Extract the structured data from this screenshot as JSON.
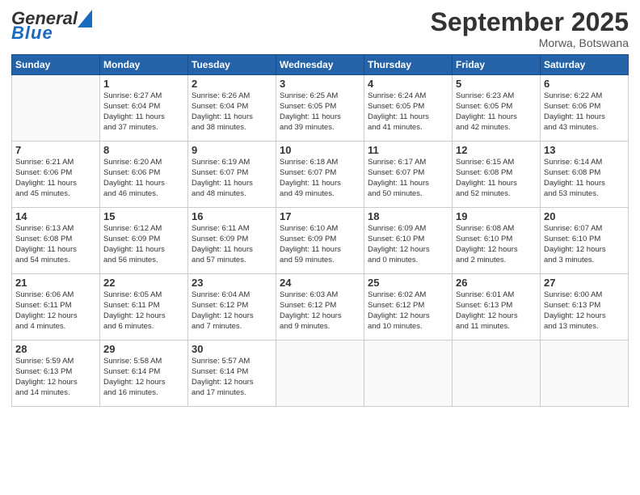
{
  "header": {
    "logo_general": "General",
    "logo_blue": "Blue",
    "month_title": "September 2025",
    "subtitle": "Morwa, Botswana"
  },
  "weekdays": [
    "Sunday",
    "Monday",
    "Tuesday",
    "Wednesday",
    "Thursday",
    "Friday",
    "Saturday"
  ],
  "weeks": [
    [
      {
        "day": "",
        "info": ""
      },
      {
        "day": "1",
        "info": "Sunrise: 6:27 AM\nSunset: 6:04 PM\nDaylight: 11 hours\nand 37 minutes."
      },
      {
        "day": "2",
        "info": "Sunrise: 6:26 AM\nSunset: 6:04 PM\nDaylight: 11 hours\nand 38 minutes."
      },
      {
        "day": "3",
        "info": "Sunrise: 6:25 AM\nSunset: 6:05 PM\nDaylight: 11 hours\nand 39 minutes."
      },
      {
        "day": "4",
        "info": "Sunrise: 6:24 AM\nSunset: 6:05 PM\nDaylight: 11 hours\nand 41 minutes."
      },
      {
        "day": "5",
        "info": "Sunrise: 6:23 AM\nSunset: 6:05 PM\nDaylight: 11 hours\nand 42 minutes."
      },
      {
        "day": "6",
        "info": "Sunrise: 6:22 AM\nSunset: 6:06 PM\nDaylight: 11 hours\nand 43 minutes."
      }
    ],
    [
      {
        "day": "7",
        "info": "Sunrise: 6:21 AM\nSunset: 6:06 PM\nDaylight: 11 hours\nand 45 minutes."
      },
      {
        "day": "8",
        "info": "Sunrise: 6:20 AM\nSunset: 6:06 PM\nDaylight: 11 hours\nand 46 minutes."
      },
      {
        "day": "9",
        "info": "Sunrise: 6:19 AM\nSunset: 6:07 PM\nDaylight: 11 hours\nand 48 minutes."
      },
      {
        "day": "10",
        "info": "Sunrise: 6:18 AM\nSunset: 6:07 PM\nDaylight: 11 hours\nand 49 minutes."
      },
      {
        "day": "11",
        "info": "Sunrise: 6:17 AM\nSunset: 6:07 PM\nDaylight: 11 hours\nand 50 minutes."
      },
      {
        "day": "12",
        "info": "Sunrise: 6:15 AM\nSunset: 6:08 PM\nDaylight: 11 hours\nand 52 minutes."
      },
      {
        "day": "13",
        "info": "Sunrise: 6:14 AM\nSunset: 6:08 PM\nDaylight: 11 hours\nand 53 minutes."
      }
    ],
    [
      {
        "day": "14",
        "info": "Sunrise: 6:13 AM\nSunset: 6:08 PM\nDaylight: 11 hours\nand 54 minutes."
      },
      {
        "day": "15",
        "info": "Sunrise: 6:12 AM\nSunset: 6:09 PM\nDaylight: 11 hours\nand 56 minutes."
      },
      {
        "day": "16",
        "info": "Sunrise: 6:11 AM\nSunset: 6:09 PM\nDaylight: 11 hours\nand 57 minutes."
      },
      {
        "day": "17",
        "info": "Sunrise: 6:10 AM\nSunset: 6:09 PM\nDaylight: 11 hours\nand 59 minutes."
      },
      {
        "day": "18",
        "info": "Sunrise: 6:09 AM\nSunset: 6:10 PM\nDaylight: 12 hours\nand 0 minutes."
      },
      {
        "day": "19",
        "info": "Sunrise: 6:08 AM\nSunset: 6:10 PM\nDaylight: 12 hours\nand 2 minutes."
      },
      {
        "day": "20",
        "info": "Sunrise: 6:07 AM\nSunset: 6:10 PM\nDaylight: 12 hours\nand 3 minutes."
      }
    ],
    [
      {
        "day": "21",
        "info": "Sunrise: 6:06 AM\nSunset: 6:11 PM\nDaylight: 12 hours\nand 4 minutes."
      },
      {
        "day": "22",
        "info": "Sunrise: 6:05 AM\nSunset: 6:11 PM\nDaylight: 12 hours\nand 6 minutes."
      },
      {
        "day": "23",
        "info": "Sunrise: 6:04 AM\nSunset: 6:12 PM\nDaylight: 12 hours\nand 7 minutes."
      },
      {
        "day": "24",
        "info": "Sunrise: 6:03 AM\nSunset: 6:12 PM\nDaylight: 12 hours\nand 9 minutes."
      },
      {
        "day": "25",
        "info": "Sunrise: 6:02 AM\nSunset: 6:12 PM\nDaylight: 12 hours\nand 10 minutes."
      },
      {
        "day": "26",
        "info": "Sunrise: 6:01 AM\nSunset: 6:13 PM\nDaylight: 12 hours\nand 11 minutes."
      },
      {
        "day": "27",
        "info": "Sunrise: 6:00 AM\nSunset: 6:13 PM\nDaylight: 12 hours\nand 13 minutes."
      }
    ],
    [
      {
        "day": "28",
        "info": "Sunrise: 5:59 AM\nSunset: 6:13 PM\nDaylight: 12 hours\nand 14 minutes."
      },
      {
        "day": "29",
        "info": "Sunrise: 5:58 AM\nSunset: 6:14 PM\nDaylight: 12 hours\nand 16 minutes."
      },
      {
        "day": "30",
        "info": "Sunrise: 5:57 AM\nSunset: 6:14 PM\nDaylight: 12 hours\nand 17 minutes."
      },
      {
        "day": "",
        "info": ""
      },
      {
        "day": "",
        "info": ""
      },
      {
        "day": "",
        "info": ""
      },
      {
        "day": "",
        "info": ""
      }
    ]
  ]
}
